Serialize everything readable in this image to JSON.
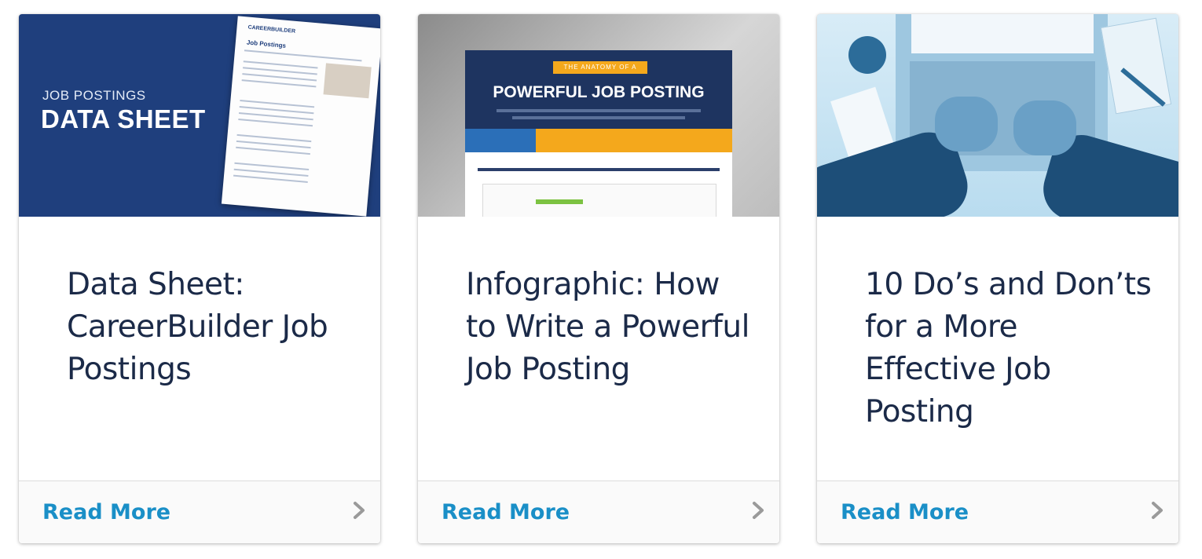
{
  "cards": [
    {
      "title": "Data Sheet: CareerBuilder Job Postings",
      "thumb": {
        "label_small": "JOB POSTINGS",
        "label_big": "DATA SHEET",
        "sheet_logo": "CAREERBUILDER",
        "sheet_heading": "Job Postings"
      },
      "cta": "Read More"
    },
    {
      "title": "Infographic: How to Write a Powerful Job Posting",
      "thumb": {
        "ribbon": "THE ANATOMY OF A",
        "headline": "POWERFUL JOB POSTING"
      },
      "cta": "Read More"
    },
    {
      "title": "10 Do’s and Don’ts for a More Effective Job Posting",
      "thumb": {},
      "cta": "Read More"
    }
  ],
  "colors": {
    "title": "#1b2a48",
    "link": "#1a8fc7",
    "navy": "#1f3f7d"
  }
}
